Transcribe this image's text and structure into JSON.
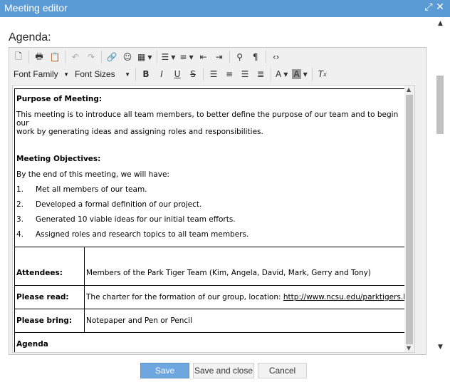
{
  "window": {
    "title": "Meeting editor"
  },
  "form": {
    "label": "Agenda:"
  },
  "toolbar": {
    "font_family": "Font Family",
    "font_sizes": "Font Sizes"
  },
  "document": {
    "purpose_heading": "Purpose of Meeting:",
    "purpose_line1": "This meeting is to introduce all team members, to better define the purpose of our team and to begin our",
    "purpose_line2": "work by generating ideas and assigning roles and responsibilities.",
    "objectives_heading": "Meeting Objectives:",
    "objectives_intro": "By the end of this meeting, we will have:",
    "objectives": [
      {
        "num": "1.",
        "text": "Met all members of our team."
      },
      {
        "num": "2.",
        "text": "Developed a formal definition of our project."
      },
      {
        "num": "3.",
        "text": "Generated 10 viable ideas for our initial team efforts."
      },
      {
        "num": "4.",
        "text": "Assigned roles and research topics to all team members."
      }
    ],
    "attendees_label": "Attendees:",
    "attendees_value": "Members of the Park Tiger Team (Kim, Angela, David, Mark, Gerry and Tony)",
    "read_label": "Please read:",
    "read_value": "The charter for the formation of our group, location: ",
    "read_link": "http://www.ncsu.edu/parktigers.htm",
    "bring_label": "Please bring:",
    "bring_value": "Notepaper and Pen or Pencil",
    "agenda_heading": "Agenda"
  },
  "footer": {
    "save": "Save",
    "save_close": "Save and close",
    "cancel": "Cancel"
  }
}
